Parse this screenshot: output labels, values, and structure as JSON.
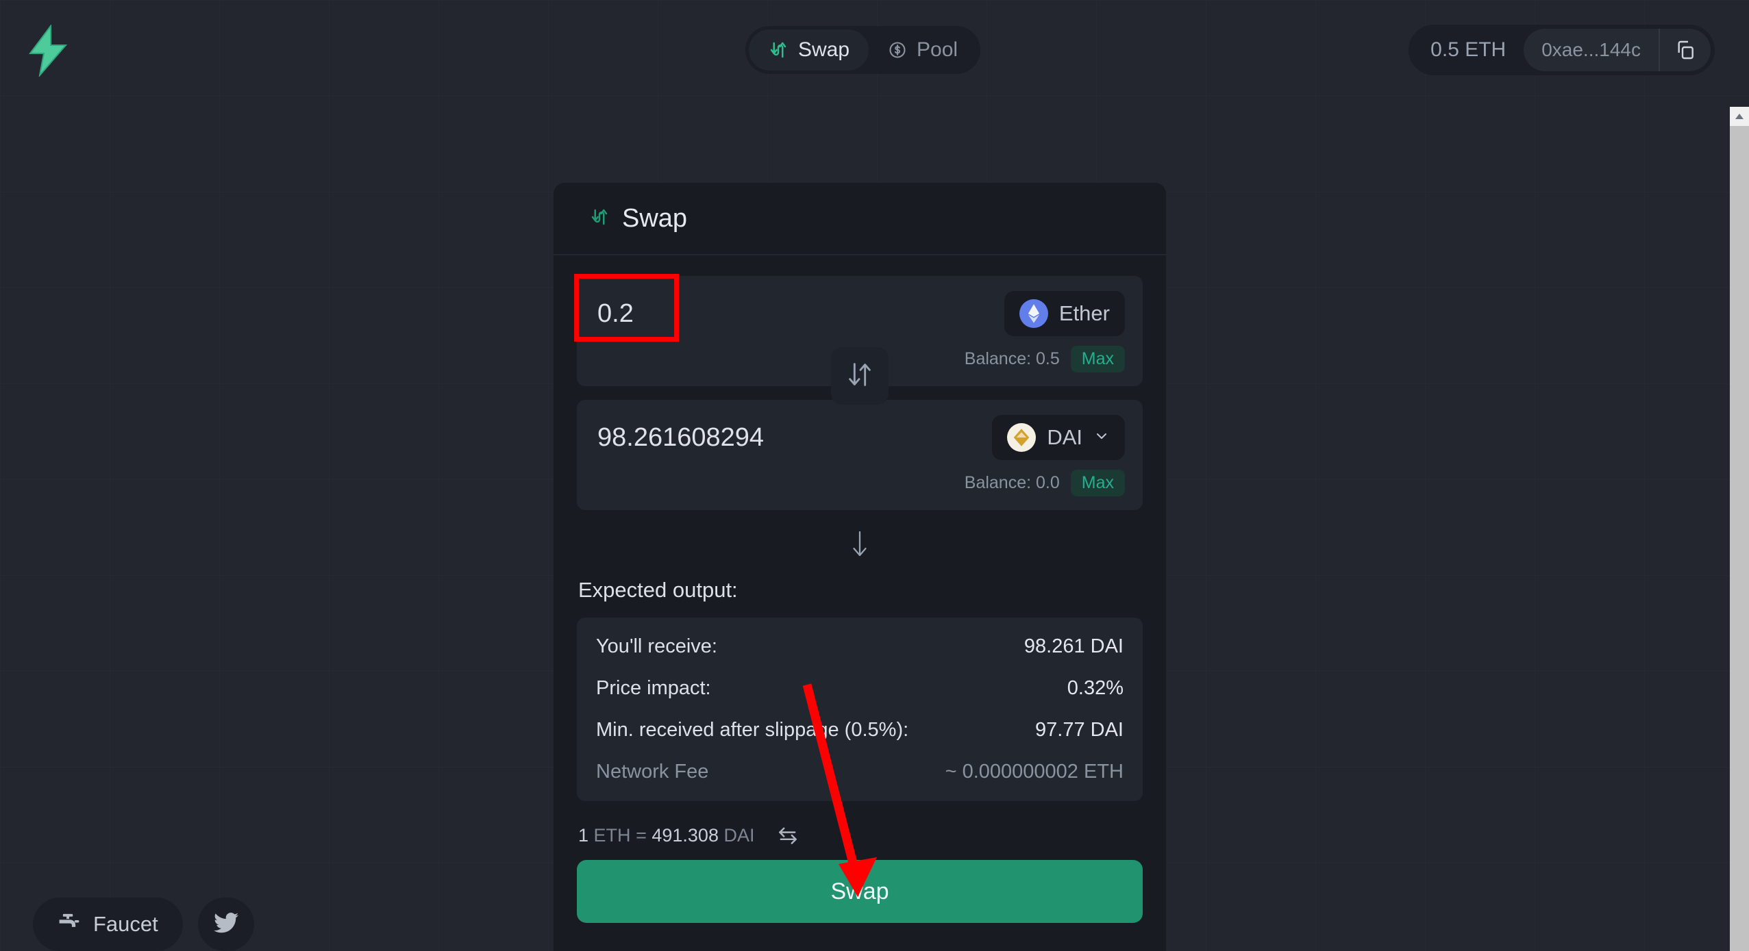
{
  "theme": {
    "page_bg": "#23262f",
    "card_bg": "#181b21",
    "panel_bg": "#22262e",
    "accent_green": "#22936f",
    "logo_green": "#4ecb9a",
    "annotation_red": "#fe0000",
    "eth_blue": "#627eea",
    "dai_gold": "#d4a12a"
  },
  "header": {
    "logo_name": "lightning-bolt-logo",
    "tabs": [
      {
        "label": "Swap",
        "icon": "swap-arrows-icon",
        "active": true
      },
      {
        "label": "Pool",
        "icon": "dollar-circle-icon",
        "active": false
      }
    ],
    "wallet": {
      "balance": "0.5 ETH",
      "address": "0xae...144c",
      "copy_icon": "copy-icon"
    }
  },
  "card": {
    "title": "Swap",
    "title_icon": "swap-arrows-icon",
    "from": {
      "amount": "0.2",
      "amount_placeholder": "0.0",
      "token": "Ether",
      "token_icon": "ethereum-icon",
      "has_chevron": false,
      "balance_label": "Balance: 0.5",
      "max_label": "Max"
    },
    "switch_icon": "down-up-arrows-icon",
    "to": {
      "amount": "98.261608294",
      "amount_placeholder": "0.0",
      "token": "DAI",
      "token_icon": "dai-icon",
      "has_chevron": true,
      "balance_label": "Balance: 0.0",
      "max_label": "Max"
    },
    "separator_icon": "arrow-down-icon",
    "expected_output_label": "Expected output:",
    "details": [
      {
        "key": "You'll receive:",
        "value": "98.261 DAI",
        "muted": false
      },
      {
        "key": "Price impact:",
        "value": "0.32%",
        "muted": false
      },
      {
        "key": "Min. received after slippage (0.5%):",
        "value": "97.77 DAI",
        "muted": false
      },
      {
        "key": "Network Fee",
        "value": "~ 0.000000002 ETH",
        "muted": true
      }
    ],
    "rate": {
      "amount": "1",
      "from_unit": "ETH",
      "equals": "=",
      "rate_value": "491.308",
      "to_unit": "DAI",
      "toggle_icon": "exchange-arrows-icon"
    },
    "submit_label": "Swap"
  },
  "footer": {
    "faucet_label": "Faucet",
    "faucet_icon": "faucet-icon",
    "twitter_icon": "twitter-bird-icon"
  },
  "scrollbar": {
    "up_arrow_icon": "scroll-up-arrow-icon"
  },
  "annotations": {
    "highlight_box_target": "amount-input",
    "arrow_target": "swap-submit-button"
  }
}
